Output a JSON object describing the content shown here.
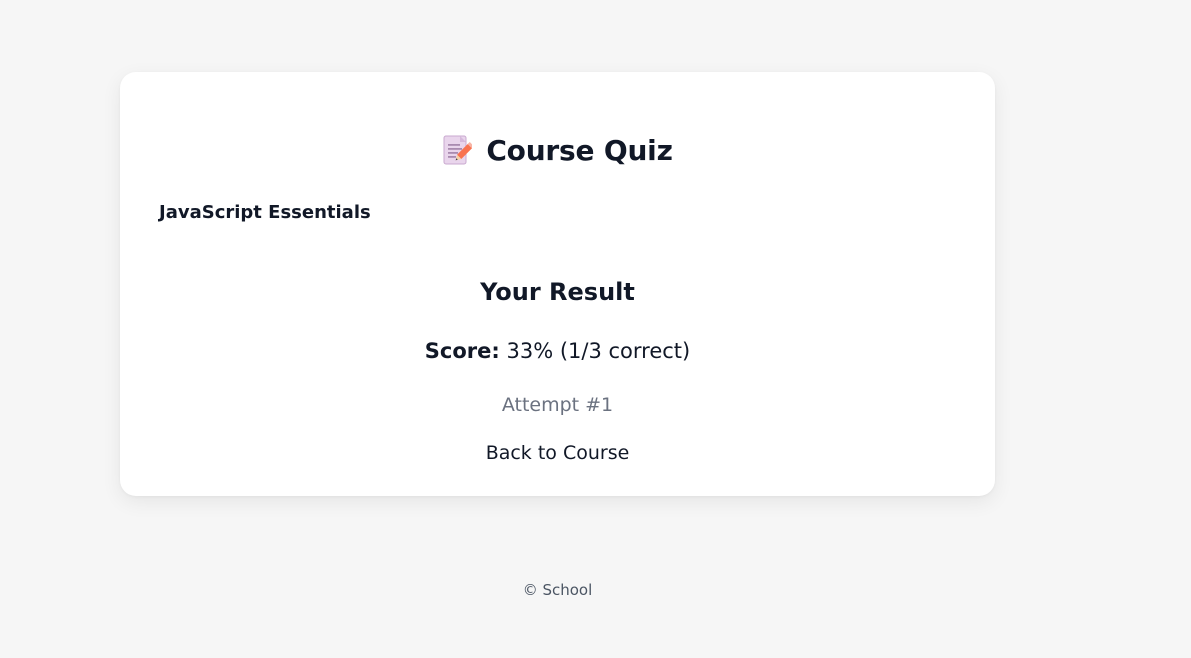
{
  "quiz": {
    "icon": "memo-document-icon",
    "title": "Course Quiz",
    "course_name": "JavaScript Essentials"
  },
  "result": {
    "heading": "Your Result",
    "score_label": "Score:",
    "score_value": "33% (1/3 correct)",
    "score_percent": 33,
    "attempt": "Attempt #1",
    "back_link": "Back to Course"
  },
  "footer": {
    "text": "© School"
  },
  "colors": {
    "background": "#f6f6f6",
    "card": "#ffffff",
    "text": "#111827",
    "muted": "#6b7280"
  }
}
